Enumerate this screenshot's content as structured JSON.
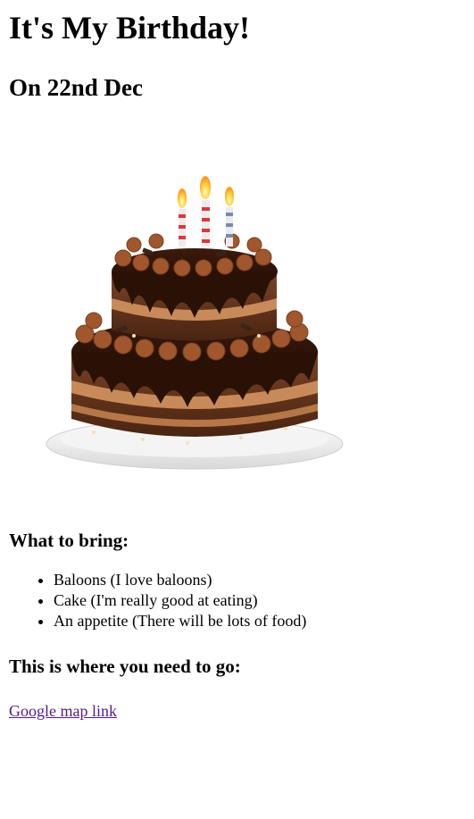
{
  "header": {
    "title": "It's My Birthday!",
    "subtitle": "On 22nd Dec"
  },
  "image": {
    "icon": "birthday-cake-image"
  },
  "bring": {
    "heading": "What to bring:",
    "items": [
      "Baloons (I love baloons)",
      "Cake (I'm really good at eating)",
      "An appetite (There will be lots of food)"
    ]
  },
  "location": {
    "heading": "This is where you need to go:",
    "link_label": "Google map link"
  },
  "colors": {
    "link": "#551a8b",
    "text": "#000000",
    "background": "#ffffff"
  }
}
